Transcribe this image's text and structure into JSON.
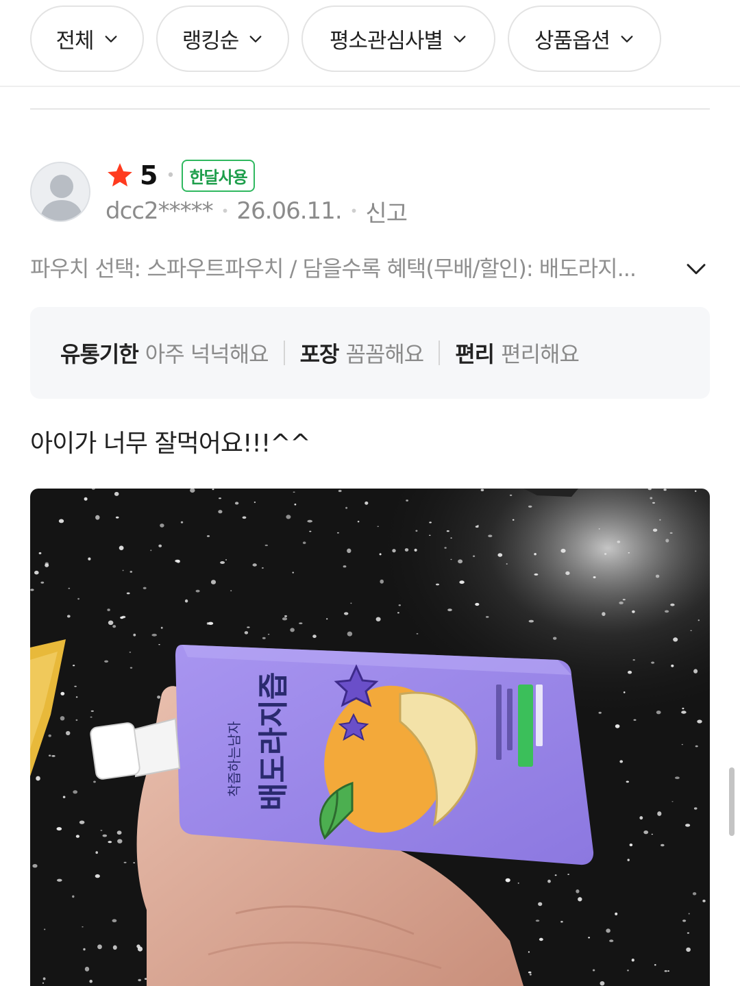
{
  "filters": [
    {
      "label": "전체"
    },
    {
      "label": "랭킹순"
    },
    {
      "label": "평소관심사별"
    },
    {
      "label": "상품옵션"
    }
  ],
  "review": {
    "rating": "5",
    "badge": "한달사용",
    "user": "dcc2*****",
    "date": "26.06.11.",
    "report": "신고",
    "option_text": "파우치 선택: 스파우트파우치 / 담을수록 혜택(무배/할인): 배도라지...",
    "survey": [
      {
        "key": "유통기한",
        "value": "아주 넉넉해요"
      },
      {
        "key": "포장",
        "value": "꼼꼼해요"
      },
      {
        "key": "편리",
        "value": "편리해요"
      }
    ],
    "text": "아이가 너무 잘먹어요!!!^^",
    "photo": {
      "pouch_name": "배도라지즙",
      "pouch_brand": "착즙하는남자"
    }
  },
  "colors": {
    "star": "#ff3b1f",
    "badge_green": "#2fb85f",
    "pouch_purple": "#9a86e8",
    "counter_black": "#141414"
  }
}
